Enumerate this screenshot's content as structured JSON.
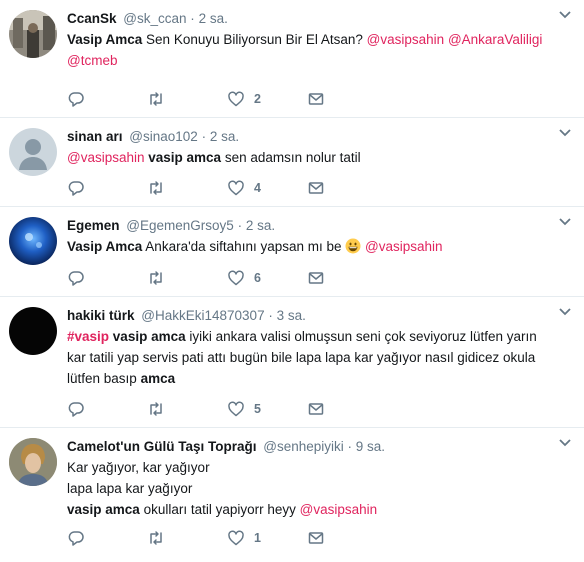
{
  "tweets": [
    {
      "name": "CcanSk",
      "handle": "@sk_ccan",
      "time": "2 sa.",
      "text_parts": [
        {
          "t": "Vasip Amca",
          "style": "bold"
        },
        {
          "t": " Sen Konuyu Biliyorsun Bir El Atsan? ",
          "style": "plain"
        },
        {
          "t": "@vasipsahin",
          "style": "mention"
        },
        {
          "t": " ",
          "style": "plain"
        },
        {
          "t": "@AnkaraValiligi",
          "style": "mention"
        },
        {
          "t": " ",
          "style": "plain"
        },
        {
          "t": "@tcmeb",
          "style": "mention"
        }
      ],
      "likes": "2"
    },
    {
      "name": "sinan arı",
      "handle": "@sinao102",
      "time": "2 sa.",
      "text_parts": [
        {
          "t": "@vasipsahin",
          "style": "mention"
        },
        {
          "t": " ",
          "style": "plain"
        },
        {
          "t": "vasip amca",
          "style": "bold"
        },
        {
          "t": " sen adamsın nolur tatil",
          "style": "plain"
        }
      ],
      "likes": "4"
    },
    {
      "name": "Egemen",
      "handle": "@EgemenGrsoy5",
      "time": "2 sa.",
      "text_parts": [
        {
          "t": "Vasip Amca",
          "style": "bold"
        },
        {
          "t": " Ankara'da siftahını yapsan mı be ",
          "style": "plain"
        },
        {
          "t": "grinning-emoji",
          "style": "emoji"
        },
        {
          "t": " ",
          "style": "plain"
        },
        {
          "t": "@vasipsahin",
          "style": "mention"
        }
      ],
      "likes": "6"
    },
    {
      "name": "hakiki türk",
      "handle": "@HakkEki14870307",
      "time": "3 sa.",
      "text_parts": [
        {
          "t": "#vasip",
          "style": "mention-bold"
        },
        {
          "t": " ",
          "style": "plain"
        },
        {
          "t": "vasip amca",
          "style": "bold"
        },
        {
          "t": " iyiki ankara valisi olmuşsun seni çok seviyoruz lütfen yarın kar tatili yap servis pati attı bugün bile lapa lapa kar yağıyor nasıl gidicez okula lütfen basıp ",
          "style": "plain"
        },
        {
          "t": "amca",
          "style": "bold"
        }
      ],
      "likes": "5"
    },
    {
      "name": "Camelot'un Gülü Taşı Toprağı",
      "handle": "@senhepiyiki",
      "time": "9 sa.",
      "text_parts": [
        {
          "t": "Kar yağıyor, kar yağıyor",
          "style": "plain"
        },
        {
          "t": "",
          "style": "br"
        },
        {
          "t": "lapa lapa kar yağıyor",
          "style": "plain"
        },
        {
          "t": "",
          "style": "br"
        },
        {
          "t": "vasip amca",
          "style": "bold"
        },
        {
          "t": " okulları tatil yapiyorr heyy ",
          "style": "plain"
        },
        {
          "t": "@vasipsahin",
          "style": "mention"
        }
      ],
      "likes": "1"
    }
  ],
  "icons": {
    "reply": "reply-icon",
    "retweet": "retweet-icon",
    "like": "heart-icon",
    "dm": "envelope-icon",
    "menu": "chevron-down-icon"
  },
  "colors": {
    "mention": "#e0245e",
    "muted": "#657786",
    "border": "#e6ecf0"
  }
}
